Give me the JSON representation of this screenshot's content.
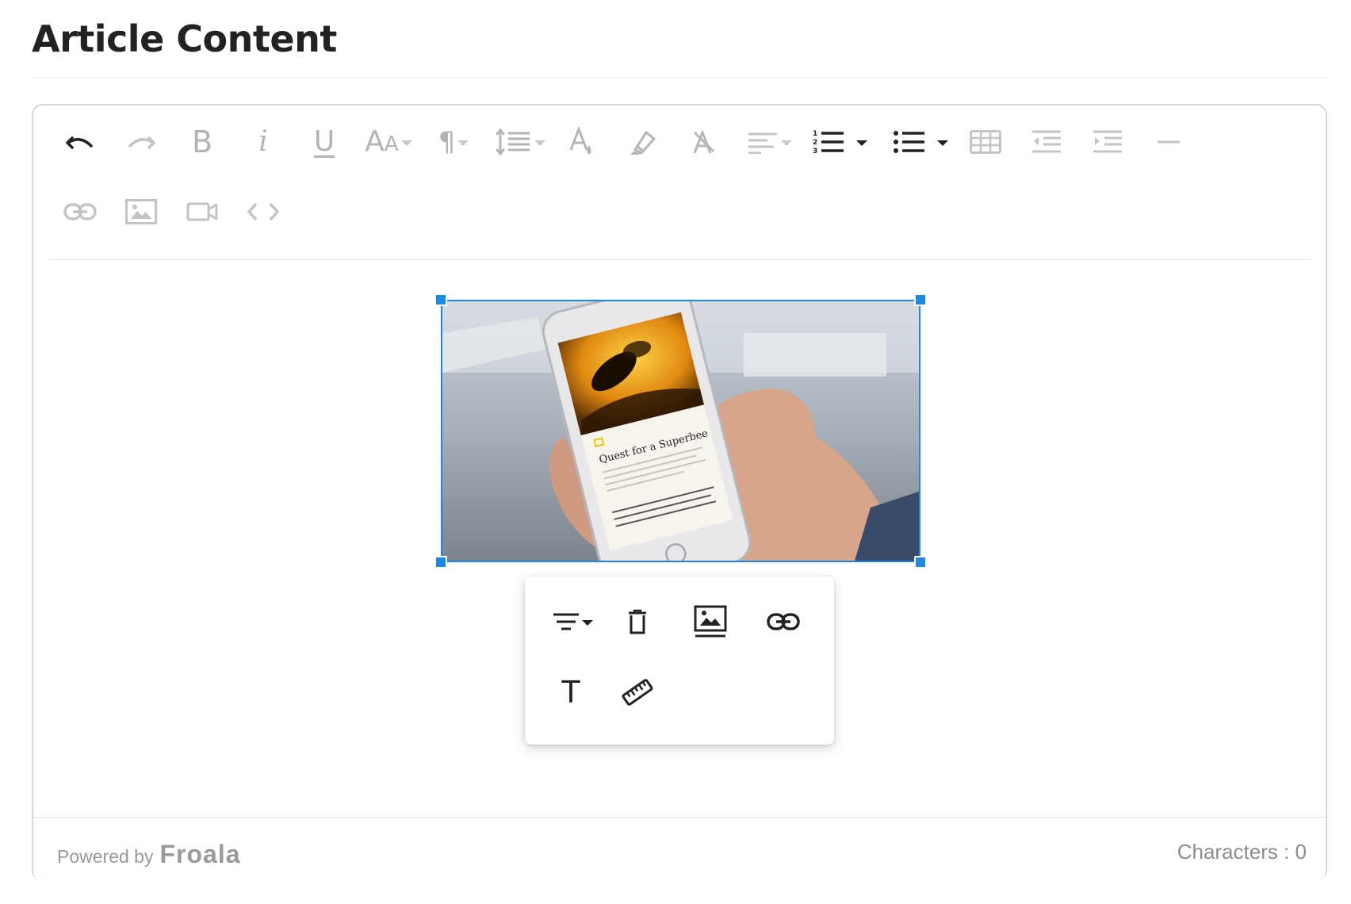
{
  "page": {
    "title": "Article Content"
  },
  "toolbar": {
    "buttons": [
      {
        "name": "undo",
        "icon": "undo-icon"
      },
      {
        "name": "redo",
        "icon": "redo-icon"
      },
      {
        "name": "bold",
        "glyph": "B"
      },
      {
        "name": "italic",
        "glyph": "i"
      },
      {
        "name": "underline",
        "glyph": "U"
      },
      {
        "name": "font-size",
        "glyph": "AA"
      },
      {
        "name": "paragraph-format",
        "glyph": "¶"
      },
      {
        "name": "line-height",
        "icon": "line-height-icon"
      },
      {
        "name": "text-color",
        "icon": "text-color-icon"
      },
      {
        "name": "highlight",
        "icon": "highlighter-icon"
      },
      {
        "name": "clear-formatting",
        "icon": "clear-formatting-icon"
      },
      {
        "name": "align",
        "icon": "align-icon"
      },
      {
        "name": "ordered-list",
        "icon": "ordered-list-icon"
      },
      {
        "name": "unordered-list",
        "icon": "unordered-list-icon"
      },
      {
        "name": "insert-table",
        "icon": "table-icon"
      },
      {
        "name": "outdent",
        "icon": "outdent-icon"
      },
      {
        "name": "indent",
        "icon": "indent-icon"
      },
      {
        "name": "horizontal-line",
        "icon": "horizontal-line-icon"
      },
      {
        "name": "insert-link",
        "icon": "link-icon"
      },
      {
        "name": "insert-image",
        "icon": "image-icon"
      },
      {
        "name": "insert-video",
        "icon": "video-icon"
      },
      {
        "name": "code-view",
        "icon": "code-icon"
      }
    ],
    "glyphs": {
      "bold": "B",
      "italic": "i",
      "underline": "U",
      "font_size_big": "A",
      "font_size_small": "A",
      "paragraph": "¶"
    }
  },
  "content": {
    "image": {
      "description_icon": "photo-phone-article-icon",
      "article_headline": "Quest for a Superbee",
      "publisher": "NATIONAL GEOGRAPHIC"
    }
  },
  "image_popup": {
    "buttons": [
      {
        "name": "image-align",
        "icon": "align-icon"
      },
      {
        "name": "remove-image",
        "icon": "trash-icon"
      },
      {
        "name": "replace-image",
        "icon": "image-replace-icon"
      },
      {
        "name": "insert-link",
        "icon": "link-icon"
      },
      {
        "name": "alt-text",
        "glyph": "T"
      },
      {
        "name": "change-size",
        "icon": "ruler-icon"
      }
    ],
    "alt_glyph": "T"
  },
  "footer": {
    "powered_by": "Powered by",
    "brand": "Froala",
    "char_count": "Characters : 0"
  },
  "colors": {
    "accent": "#1e88e5",
    "icon_active": "#222222",
    "icon_disabled": "#b4b4b4"
  }
}
